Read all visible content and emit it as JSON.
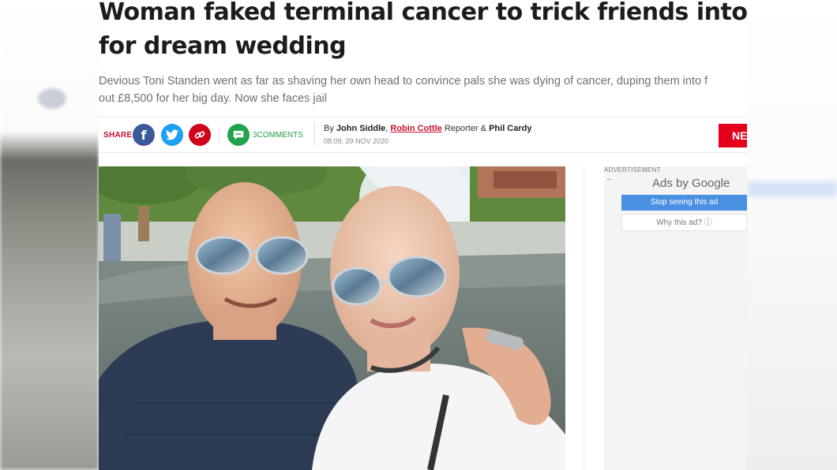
{
  "article": {
    "headline_line1": "Woman faked terminal cancer to trick friends into payin",
    "headline_line2": "for dream wedding",
    "standfirst_line1": "Devious Toni Standen went as far as shaving her own head to convince pals she was dying of cancer, duping them into f",
    "standfirst_line2": "out £8,500 for her big day. Now she faces jail"
  },
  "share": {
    "label": "SHARE",
    "facebook_icon": "f",
    "twitter_icon": "t",
    "link_icon": "⛓",
    "comment_icon": "comment-icon",
    "comment_count": "3",
    "comments_label": "COMMENTS"
  },
  "byline": {
    "prefix": "By ",
    "author1": "John Siddle",
    "comma": ", ",
    "author2": "Robin Cottle",
    "role": " Reporter & ",
    "author3": "Phil Cardy",
    "date": "08:09, 29 NOV 2020"
  },
  "badge": {
    "label": "NE"
  },
  "ad": {
    "advertisement_label": "ADVERTISEMENT",
    "back_arrow": "←",
    "ads_by_prefix": "Ads by ",
    "ads_by_brand": "Google",
    "stop_label": "Stop seeing this ad",
    "why_label": "Why this ad? ⓘ"
  },
  "colors": {
    "brand_red": "#c8102e",
    "facebook": "#3b5998",
    "twitter": "#1da1f2",
    "comments_green": "#21a34c",
    "ad_button_blue": "#4a90e2"
  }
}
